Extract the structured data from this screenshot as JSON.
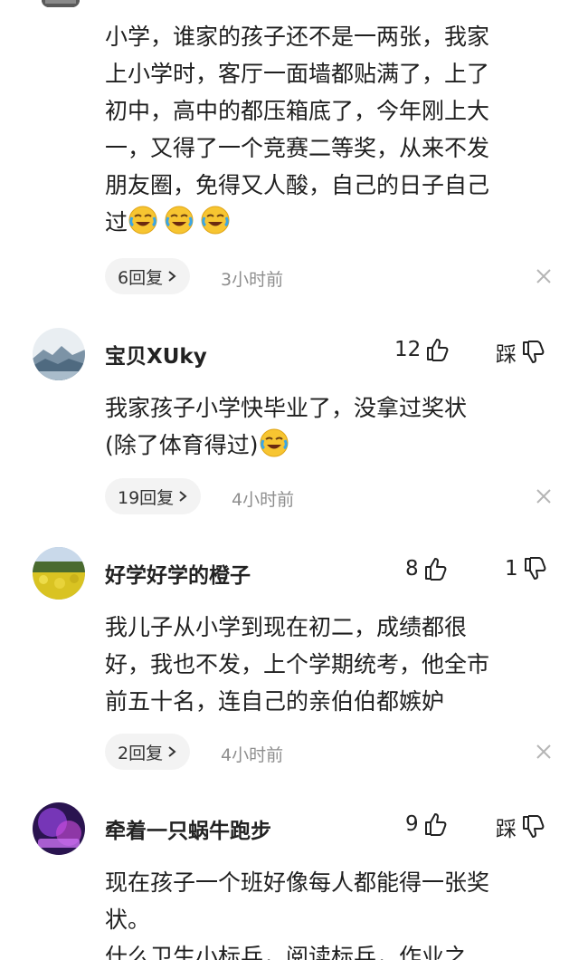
{
  "comments": [
    {
      "username": "",
      "likes": "",
      "dislike_label": "",
      "text_lines": [
        "小学，谁家的孩子还不是一两张，我家",
        "上小学时，客厅一面墙都贴满了，上了",
        "初中，高中的都压箱底了，今年刚上大",
        "一，又得了一个竞赛二等奖，从来不发",
        "朋友圈，免得又人酸，自己的日子自己"
      ],
      "last_line": "过",
      "emoji_count": 3,
      "replies": "6回复",
      "time": "3小时前"
    },
    {
      "username": "宝贝XUky",
      "likes": "12",
      "dislike_label": "踩",
      "text_lines": [
        "我家孩子小学快毕业了，没拿过奖状"
      ],
      "last_line": "(除了体育得过)",
      "emoji_count": 1,
      "replies": "19回复",
      "time": "4小时前"
    },
    {
      "username": "好学好学的橙子",
      "likes": "8",
      "dislike_label": "1",
      "text_lines": [
        "我儿子从小学到现在初二，成绩都很",
        "好，我也不发，上个学期统考，他全市",
        "前五十名，连自己的亲伯伯都嫉妒"
      ],
      "replies": "2回复",
      "time": "4小时前"
    },
    {
      "username": "牵着一只蜗牛跑步",
      "likes": "9",
      "dislike_label": "踩",
      "text_lines": [
        "现在孩子一个班好像每人都能得一张奖",
        "状。",
        "什么卫生小标兵，阅读标兵，作业之"
      ]
    }
  ],
  "colors": {
    "text": "#1f1f1f",
    "meta": "#8e8e8e",
    "pill_bg": "#f3f3f3"
  }
}
